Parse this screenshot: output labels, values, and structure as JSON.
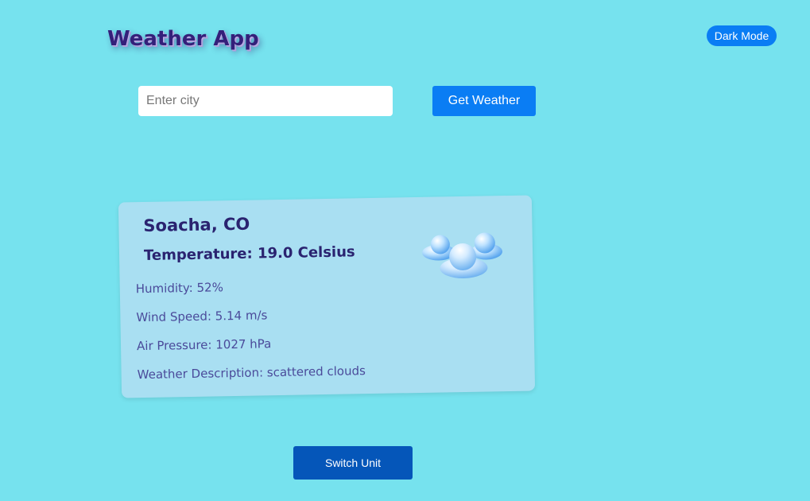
{
  "header": {
    "title": "Weather App",
    "dark_mode_label": "Dark Mode"
  },
  "search": {
    "placeholder": "Enter city",
    "value": "",
    "button_label": "Get Weather"
  },
  "weather": {
    "city": "Soacha, CO",
    "temperature": "Temperature: 19.0 Celsius",
    "humidity": "Humidity: 52%",
    "wind_speed": "Wind Speed: 5.14 m/s",
    "air_pressure": "Air Pressure: 1027 hPa",
    "description": "Weather Description: scattered clouds",
    "icon": "scattered-clouds-icon"
  },
  "footer": {
    "switch_unit_label": "Switch Unit"
  },
  "colors": {
    "background": "#76E2EE",
    "primary_button": "#0A7DF4",
    "switch_button": "#0556B9",
    "card": "#A9DFF2",
    "title_text": "#34207A",
    "detail_text": "#4A4A9A"
  }
}
